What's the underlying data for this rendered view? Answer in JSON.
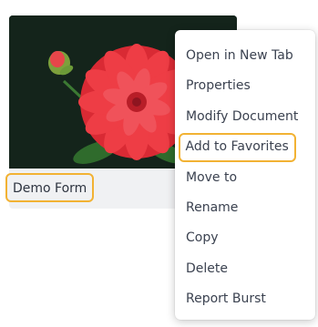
{
  "card": {
    "label": "Demo Form",
    "thumbnail_alt": "red dahlia flower"
  },
  "context_menu": {
    "items": [
      {
        "label": "Open in New Tab",
        "highlighted": false
      },
      {
        "label": "Properties",
        "highlighted": false
      },
      {
        "label": "Modify Document",
        "highlighted": false
      },
      {
        "label": "Add to Favorites",
        "highlighted": true
      },
      {
        "label": "Move to",
        "highlighted": false
      },
      {
        "label": "Rename",
        "highlighted": false
      },
      {
        "label": "Copy",
        "highlighted": false
      },
      {
        "label": "Delete",
        "highlighted": false
      },
      {
        "label": "Report Burst",
        "highlighted": false
      }
    ]
  },
  "colors": {
    "highlight_border": "#f2b233",
    "menu_text": "#3b4250",
    "card_background": "#f0f1f3",
    "thumbnail_background": "#14241b",
    "flower": "#e8323c"
  }
}
